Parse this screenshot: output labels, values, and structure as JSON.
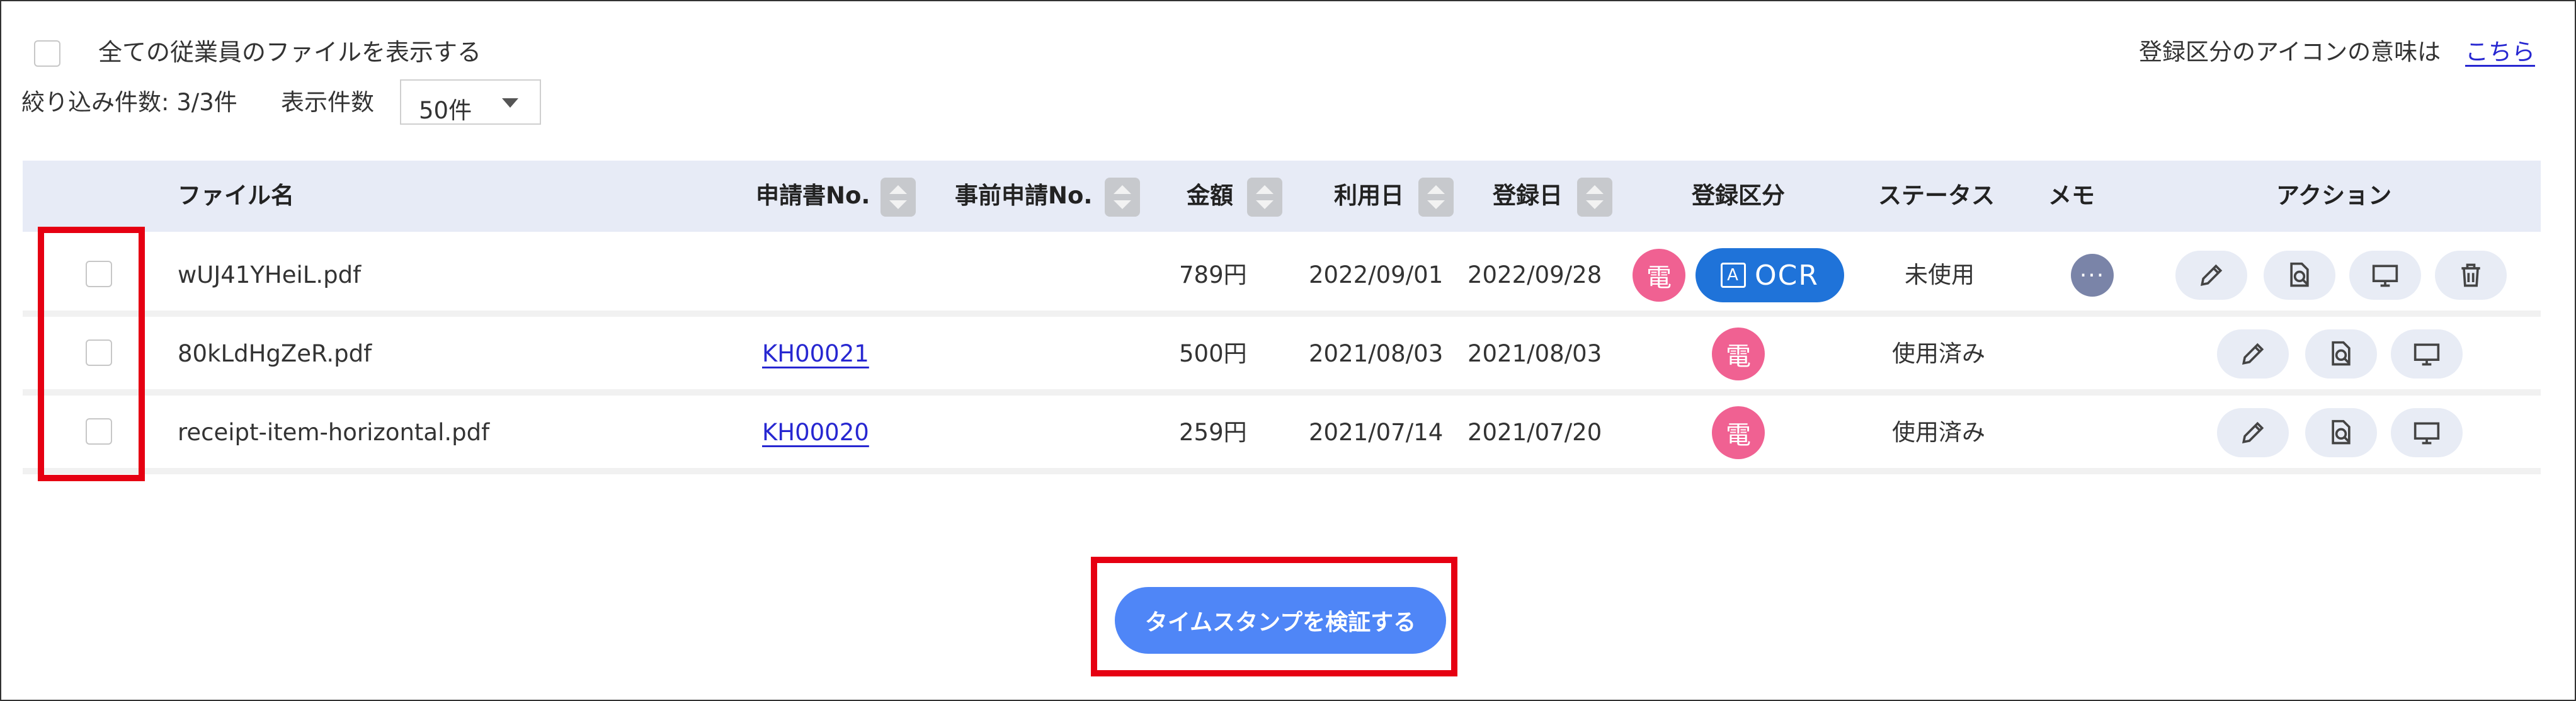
{
  "top": {
    "show_all_label": "全ての従業員のファイルを表示する",
    "legend_text": "登録区分のアイコンの意味は",
    "legend_link": "こちら",
    "filter_count": "絞り込み件数: 3/3件",
    "display_count_label": "表示件数",
    "display_count_value": "50件"
  },
  "table": {
    "headers": {
      "filename": "ファイル名",
      "application_no": "申請書No.",
      "pre_application_no": "事前申請No.",
      "amount": "金額",
      "use_date": "利用日",
      "registration_date": "登録日",
      "registration_type": "登録区分",
      "status": "ステータス",
      "memo": "メモ",
      "action": "アクション"
    },
    "rows": [
      {
        "filename": "wUJ41YHeiL.pdf",
        "application_no": "",
        "pre_application_no": "",
        "amount": "789円",
        "use_date": "2022/09/01",
        "registration_date": "2022/09/28",
        "type_badge": "電",
        "ocr_badge": "OCR",
        "ocr_glyph": "A",
        "status": "未使用",
        "memo": "···"
      },
      {
        "filename": "80kLdHgZeR.pdf",
        "application_no": "KH00021",
        "pre_application_no": "",
        "amount": "500円",
        "use_date": "2021/08/03",
        "registration_date": "2021/08/03",
        "type_badge": "電",
        "status": "使用済み"
      },
      {
        "filename": "receipt-item-horizontal.pdf",
        "application_no": "KH00020",
        "pre_application_no": "",
        "amount": "259円",
        "use_date": "2021/07/14",
        "registration_date": "2021/07/20",
        "type_badge": "電",
        "status": "使用済み"
      }
    ]
  },
  "verify_button": "タイムスタンプを検証する",
  "colors": {
    "header_bg": "#e7ebf6",
    "den_badge": "#f06192",
    "ocr_badge": "#1f73d9",
    "memo_badge": "#7a84a8",
    "action_btn": "#e8ecf5",
    "primary_button": "#4f86f7",
    "highlight": "#e60012",
    "link": "#2727d1"
  },
  "icons": {
    "edit": "pencil-icon",
    "preview": "document-search-icon",
    "display": "monitor-icon",
    "delete": "trash-icon",
    "sort": "sort-arrows-icon",
    "dropdown": "caret-down-icon"
  }
}
